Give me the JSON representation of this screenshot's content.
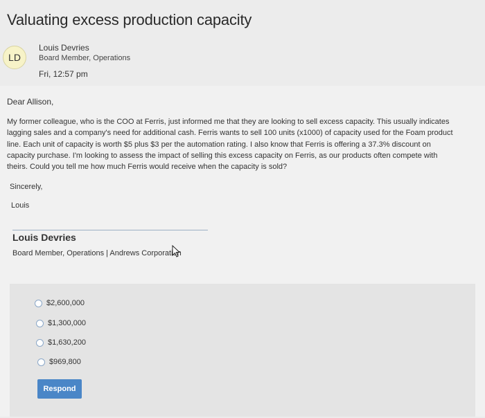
{
  "page_title": "Valuating excess production capacity",
  "sender": {
    "initials": "LD",
    "name": "Louis Devries",
    "role": "Board Member, Operations",
    "timestamp": "Fri, 12:57 pm"
  },
  "message": {
    "greeting": "Dear Allison,",
    "paragraph_lines": [
      "My former colleague, who is the COO at Ferris, just informed me that they are looking to sell excess capacity. This usually indicates",
      "lagging sales and a company's need for additional cash. Ferris wants to sell 100 units (x1000) of capacity used for the Foam product",
      "line. Each unit of capacity is worth $5 plus $3 per the automation rating. I also know that Ferris is offering a 37.3% discount on",
      "capacity purchase. I'm looking to assess the impact of selling this excess capacity on Ferris, as our products often compete with",
      "theirs. Could you tell me how much Ferris would receive when the capacity is sold?"
    ],
    "closing": "Sincerely,",
    "signoff": "Louis"
  },
  "signature": {
    "name": "Louis Devries",
    "title": "Board Member, Operations | Andrews Corporation"
  },
  "options": [
    {
      "label": "$2,600,000"
    },
    {
      "label": "$1,300,000"
    },
    {
      "label": "$1,630,200"
    },
    {
      "label": "$969,800"
    }
  ],
  "respond_label": "Respond",
  "colors": {
    "accent": "#4a86c7",
    "avatar_bg": "#f7f3c8",
    "panel_bg": "#e4e4e4"
  }
}
